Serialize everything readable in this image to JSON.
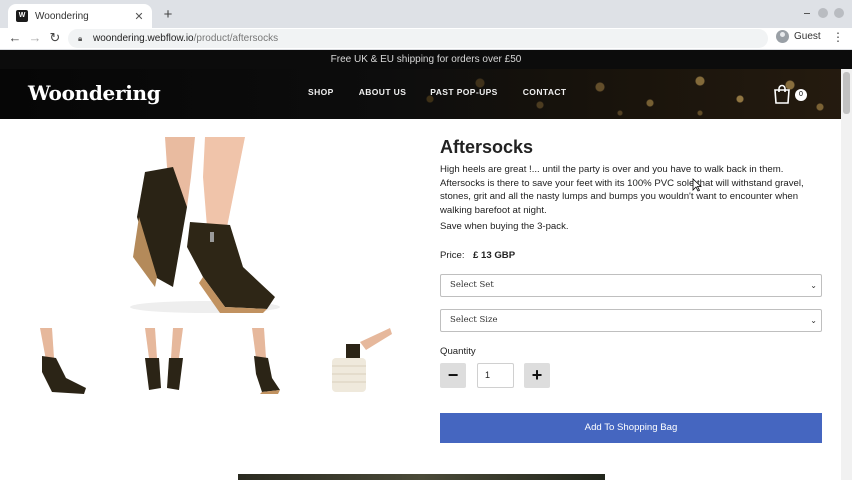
{
  "browser": {
    "tab_title": "Woondering",
    "favicon_letter": "W",
    "new_tab_symbol": "+",
    "url_host": "woondering.webflow.io",
    "url_path": "/product/aftersocks",
    "profile_label": "Guest"
  },
  "site": {
    "promo_text": "Free UK & EU shipping for orders over £50",
    "brand": "Woondering",
    "nav": {
      "shop": "SHOP",
      "about": "ABOUT US",
      "past": "PAST POP-UPS",
      "contact": "CONTACT"
    },
    "cart_count": "0"
  },
  "product": {
    "title": "Aftersocks",
    "description": "High heels are great !... until the party is over and you have to walk back in them. Aftersocks is there to save your feet with its 100% PVC sole that will withstand gravel, stones, grit and all the nasty lumps and bumps you wouldn't want to encounter when walking barefoot at night.",
    "save_note": "Save when buying the 3-pack.",
    "price_label": "Price:",
    "price": "£ 13 GBP",
    "select_set": "Select Set",
    "select_size": "Select Size",
    "quantity_label": "Quantity",
    "quantity_value": "1",
    "minus_symbol": "−",
    "plus_symbol": "+",
    "add_button": "Add To Shopping Bag"
  },
  "icons": {
    "back": "back-arrow-icon",
    "forward": "forward-arrow-icon",
    "reload": "reload-icon",
    "lock": "lock-icon",
    "bag": "shopping-bag-icon"
  },
  "colors": {
    "accent": "#4566c0",
    "promo_bg": "#0c0c0c"
  }
}
